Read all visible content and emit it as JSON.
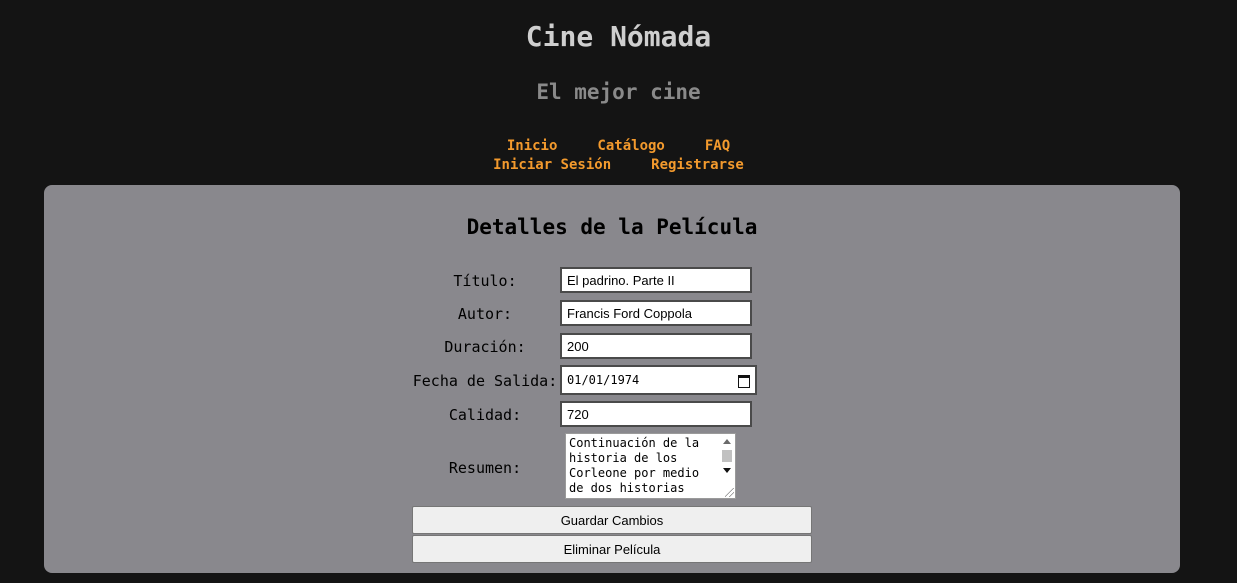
{
  "header": {
    "title": "Cine Nómada",
    "subtitle": "El mejor cine"
  },
  "nav": {
    "row1": [
      "Inicio",
      "Catálogo",
      "FAQ"
    ],
    "row2": [
      "Iniciar Sesión",
      "Registrarse"
    ]
  },
  "panel": {
    "title": "Detalles de la Película"
  },
  "form": {
    "titulo_label": "Título:",
    "titulo_value": "El padrino. Parte II",
    "autor_label": "Autor:",
    "autor_value": "Francis Ford Coppola",
    "duracion_label": "Duración:",
    "duracion_value": "200",
    "fecha_label": "Fecha de Salida:",
    "fecha_value": "01/01/1974",
    "calidad_label": "Calidad:",
    "calidad_value": "720",
    "resumen_label": "Resumen:",
    "resumen_value": "Continuación de la historia de los Corleone por medio de dos historias"
  },
  "buttons": {
    "save": "Guardar Cambios",
    "delete": "Eliminar Película"
  },
  "colors": {
    "background": "#141414",
    "accent": "#f39a2d",
    "panel": "#89888d"
  }
}
